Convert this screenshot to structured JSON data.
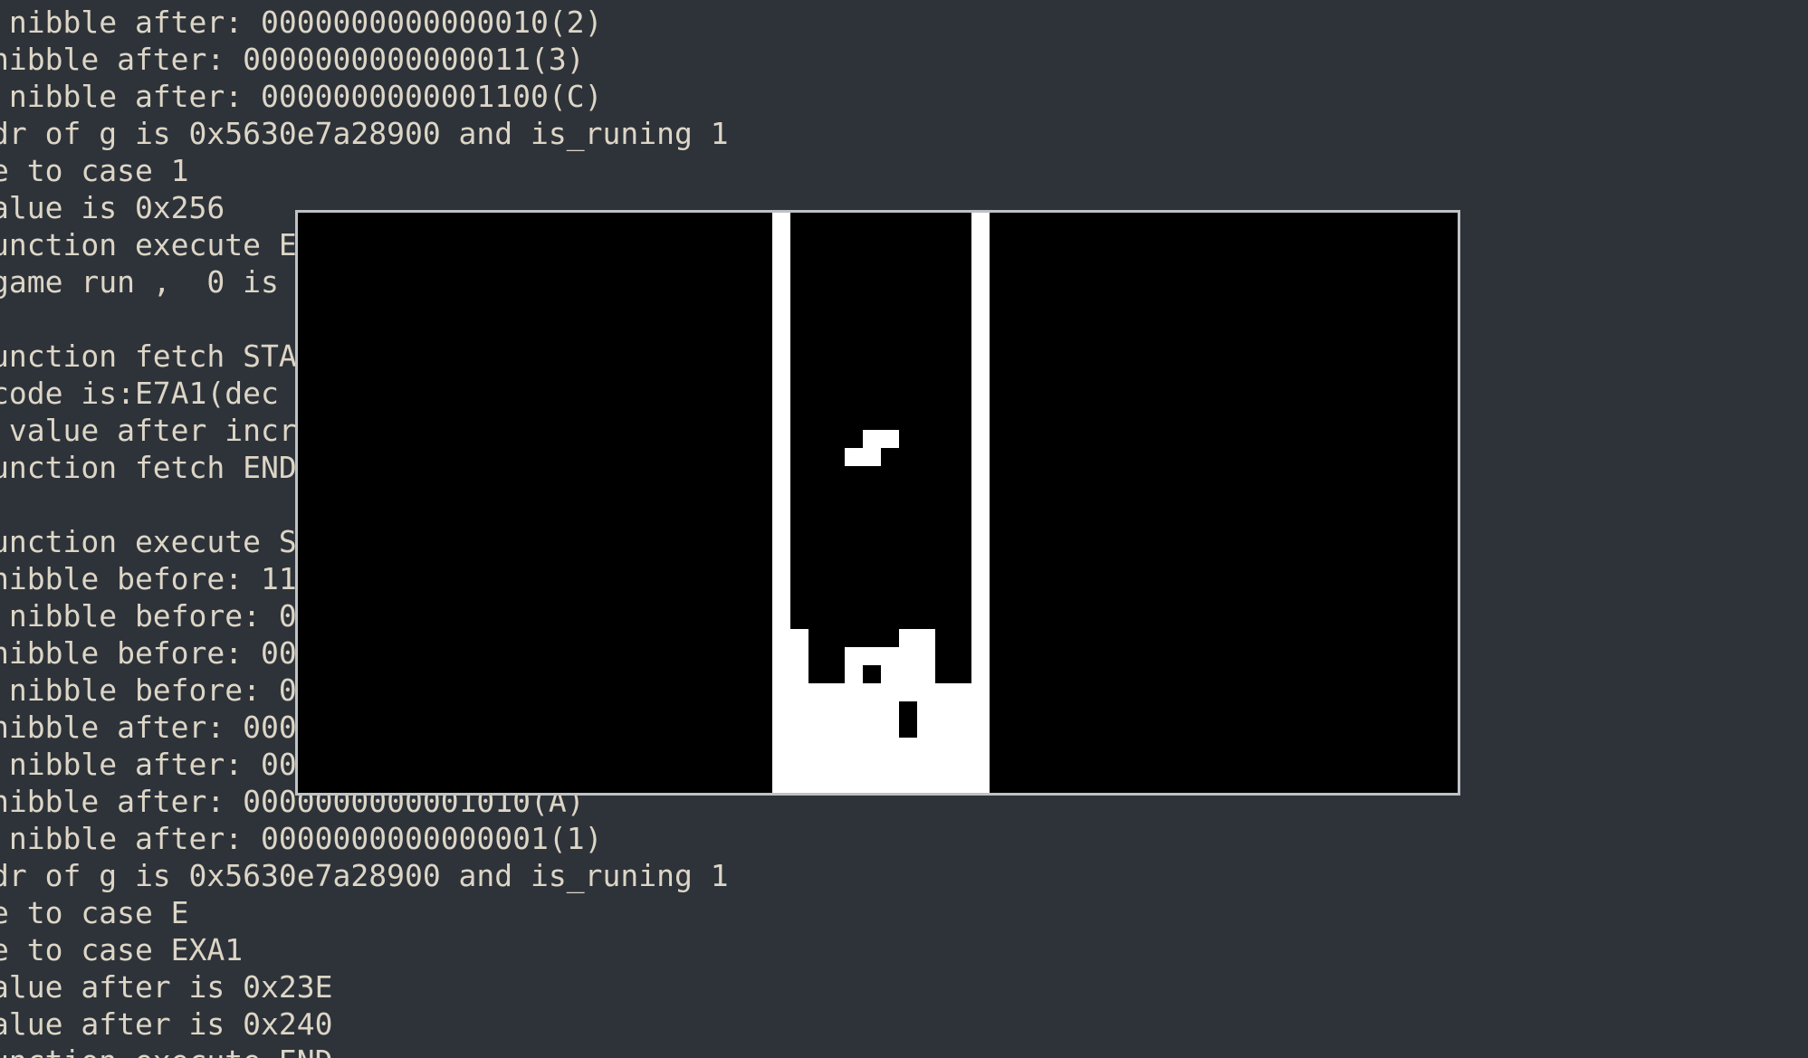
{
  "terminal": {
    "lines": [
      " nibble after: 0000000000000010(2)",
      "nibble after: 0000000000000011(3)",
      " nibble after: 0000000000001100(C)",
      "dr of g is 0x5630e7a28900 and is_runing 1",
      "e to case 1",
      "alue is 0x256",
      "unction execute E",
      "game run ,  0 is",
      "",
      "unction fetch STA",
      "code is:E7A1(dec",
      " value after incr",
      "unction fetch END",
      "",
      "unction execute S",
      "nibble before: 11",
      " nibble before: 0",
      "nibble before: 00",
      " nibble before: 0",
      "nibble after: 000",
      " nibble after: 00",
      "nibble after: 0000000000001010(A)",
      " nibble after: 0000000000000001(1)",
      "dr of g is 0x5630e7a28900 and is_runing 1",
      "e to case E",
      "e to case EXA1",
      "alue after is 0x23E",
      "alue after is 0x240",
      "unction execute END"
    ]
  },
  "game": {
    "foreground": "#ffffff",
    "background": "#000000"
  },
  "colors": {
    "terminal_bg": "#2e333a",
    "terminal_fg": "#ddd6c6",
    "window_border": "#bfc2c4"
  }
}
